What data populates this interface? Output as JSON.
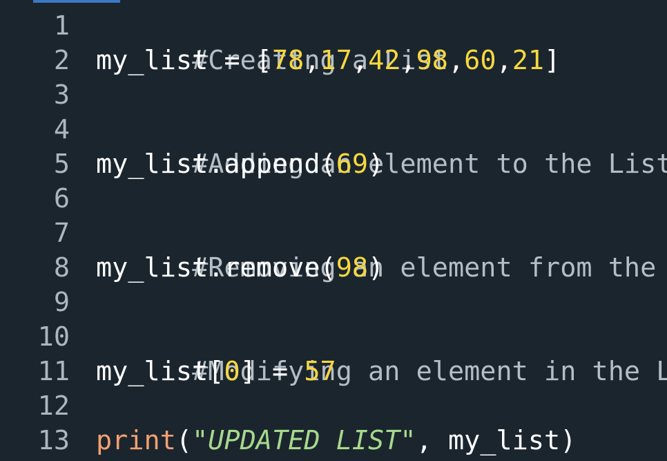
{
  "editor": {
    "tab_indicator_color": "#3a78c4",
    "background": "#1b252e",
    "line_numbers": [
      "1",
      "2",
      "3",
      "4",
      "5",
      "6",
      "7",
      "8",
      "9",
      "10",
      "11",
      "12",
      "13"
    ],
    "lines": {
      "l1": {
        "comment": "#Creattng a List"
      },
      "l2": {
        "var": "my_list",
        "op": " = [",
        "v1": "78",
        "c1": ",",
        "v2": "17",
        "c2": ",",
        "v3": "42",
        "c3": ",",
        "v4": "98",
        "c4": ",",
        "v5": "60",
        "c5": ",",
        "v6": "21",
        "end": "]"
      },
      "l4": {
        "comment": "#Adding an element to the List"
      },
      "l5": {
        "call": "my_list.append(",
        "arg": "69",
        "end": ")"
      },
      "l7": {
        "comment": "#Removing an element from the List"
      },
      "l8": {
        "call": "my_list.remove(",
        "arg": "98",
        "end": ")"
      },
      "l10": {
        "comment": "#Modifying an element in the List"
      },
      "l11": {
        "pre": "my_list[",
        "idx": "0",
        "mid": "] = ",
        "val": "57"
      },
      "l13": {
        "fn": "print",
        "open": "(",
        "str": "\"UPDATED LIST\"",
        "rest": ", my_list)"
      }
    }
  }
}
